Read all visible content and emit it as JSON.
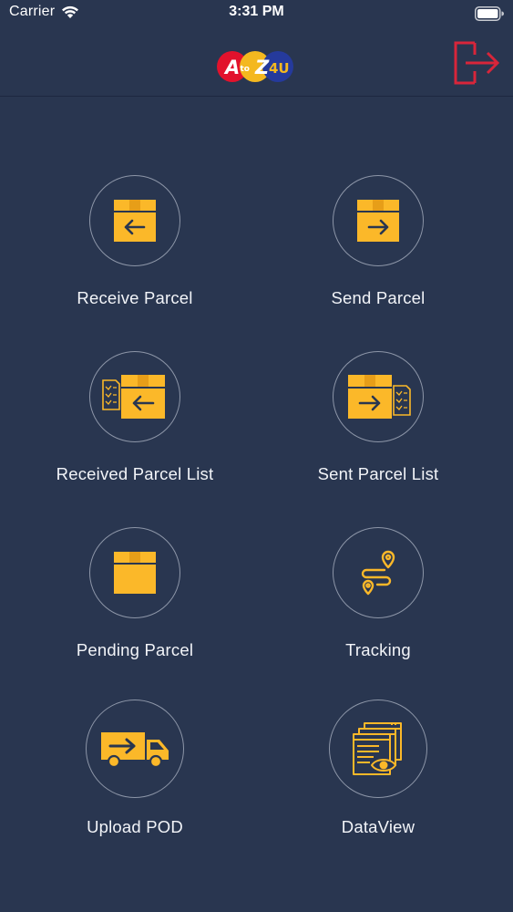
{
  "status_bar": {
    "carrier": "Carrier",
    "time": "3:31 PM"
  },
  "header": {
    "logo_text": {
      "a": "A",
      "to": "to",
      "z": "Z",
      "suffix": "4U"
    },
    "logout_icon": "logout-icon"
  },
  "colors": {
    "background": "#293650",
    "accent_yellow": "#fbb829",
    "logout_red": "#d8253a",
    "circle_border": "#8d96a8"
  },
  "menu": {
    "items": [
      {
        "label": "Receive Parcel",
        "icon": "receive-parcel-icon"
      },
      {
        "label": "Send Parcel",
        "icon": "send-parcel-icon"
      },
      {
        "label": "Received Parcel List",
        "icon": "received-list-icon"
      },
      {
        "label": "Sent Parcel List",
        "icon": "sent-list-icon"
      },
      {
        "label": "Pending Parcel",
        "icon": "pending-parcel-icon"
      },
      {
        "label": "Tracking",
        "icon": "tracking-icon"
      },
      {
        "label": "Upload POD",
        "icon": "delivery-truck-icon"
      },
      {
        "label": "DataView",
        "icon": "dataview-icon"
      }
    ]
  }
}
